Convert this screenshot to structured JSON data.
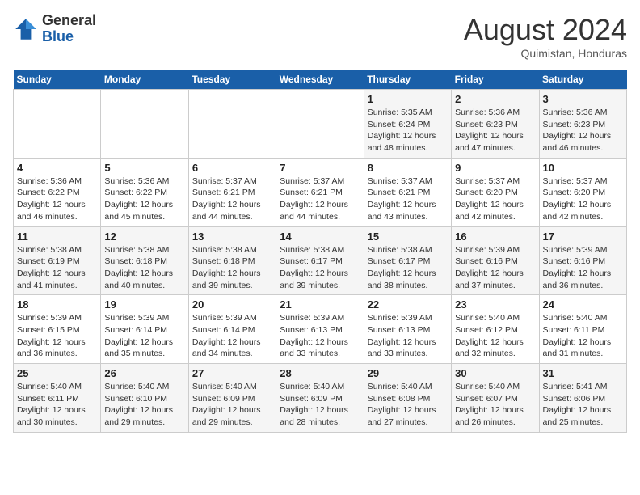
{
  "logo": {
    "general": "General",
    "blue": "Blue"
  },
  "title": "August 2024",
  "subtitle": "Quimistan, Honduras",
  "days_of_week": [
    "Sunday",
    "Monday",
    "Tuesday",
    "Wednesday",
    "Thursday",
    "Friday",
    "Saturday"
  ],
  "weeks": [
    [
      {
        "day": "",
        "info": ""
      },
      {
        "day": "",
        "info": ""
      },
      {
        "day": "",
        "info": ""
      },
      {
        "day": "",
        "info": ""
      },
      {
        "day": "1",
        "info": "Sunrise: 5:35 AM\nSunset: 6:24 PM\nDaylight: 12 hours\nand 48 minutes."
      },
      {
        "day": "2",
        "info": "Sunrise: 5:36 AM\nSunset: 6:23 PM\nDaylight: 12 hours\nand 47 minutes."
      },
      {
        "day": "3",
        "info": "Sunrise: 5:36 AM\nSunset: 6:23 PM\nDaylight: 12 hours\nand 46 minutes."
      }
    ],
    [
      {
        "day": "4",
        "info": "Sunrise: 5:36 AM\nSunset: 6:22 PM\nDaylight: 12 hours\nand 46 minutes."
      },
      {
        "day": "5",
        "info": "Sunrise: 5:36 AM\nSunset: 6:22 PM\nDaylight: 12 hours\nand 45 minutes."
      },
      {
        "day": "6",
        "info": "Sunrise: 5:37 AM\nSunset: 6:21 PM\nDaylight: 12 hours\nand 44 minutes."
      },
      {
        "day": "7",
        "info": "Sunrise: 5:37 AM\nSunset: 6:21 PM\nDaylight: 12 hours\nand 44 minutes."
      },
      {
        "day": "8",
        "info": "Sunrise: 5:37 AM\nSunset: 6:21 PM\nDaylight: 12 hours\nand 43 minutes."
      },
      {
        "day": "9",
        "info": "Sunrise: 5:37 AM\nSunset: 6:20 PM\nDaylight: 12 hours\nand 42 minutes."
      },
      {
        "day": "10",
        "info": "Sunrise: 5:37 AM\nSunset: 6:20 PM\nDaylight: 12 hours\nand 42 minutes."
      }
    ],
    [
      {
        "day": "11",
        "info": "Sunrise: 5:38 AM\nSunset: 6:19 PM\nDaylight: 12 hours\nand 41 minutes."
      },
      {
        "day": "12",
        "info": "Sunrise: 5:38 AM\nSunset: 6:18 PM\nDaylight: 12 hours\nand 40 minutes."
      },
      {
        "day": "13",
        "info": "Sunrise: 5:38 AM\nSunset: 6:18 PM\nDaylight: 12 hours\nand 39 minutes."
      },
      {
        "day": "14",
        "info": "Sunrise: 5:38 AM\nSunset: 6:17 PM\nDaylight: 12 hours\nand 39 minutes."
      },
      {
        "day": "15",
        "info": "Sunrise: 5:38 AM\nSunset: 6:17 PM\nDaylight: 12 hours\nand 38 minutes."
      },
      {
        "day": "16",
        "info": "Sunrise: 5:39 AM\nSunset: 6:16 PM\nDaylight: 12 hours\nand 37 minutes."
      },
      {
        "day": "17",
        "info": "Sunrise: 5:39 AM\nSunset: 6:16 PM\nDaylight: 12 hours\nand 36 minutes."
      }
    ],
    [
      {
        "day": "18",
        "info": "Sunrise: 5:39 AM\nSunset: 6:15 PM\nDaylight: 12 hours\nand 36 minutes."
      },
      {
        "day": "19",
        "info": "Sunrise: 5:39 AM\nSunset: 6:14 PM\nDaylight: 12 hours\nand 35 minutes."
      },
      {
        "day": "20",
        "info": "Sunrise: 5:39 AM\nSunset: 6:14 PM\nDaylight: 12 hours\nand 34 minutes."
      },
      {
        "day": "21",
        "info": "Sunrise: 5:39 AM\nSunset: 6:13 PM\nDaylight: 12 hours\nand 33 minutes."
      },
      {
        "day": "22",
        "info": "Sunrise: 5:39 AM\nSunset: 6:13 PM\nDaylight: 12 hours\nand 33 minutes."
      },
      {
        "day": "23",
        "info": "Sunrise: 5:40 AM\nSunset: 6:12 PM\nDaylight: 12 hours\nand 32 minutes."
      },
      {
        "day": "24",
        "info": "Sunrise: 5:40 AM\nSunset: 6:11 PM\nDaylight: 12 hours\nand 31 minutes."
      }
    ],
    [
      {
        "day": "25",
        "info": "Sunrise: 5:40 AM\nSunset: 6:11 PM\nDaylight: 12 hours\nand 30 minutes."
      },
      {
        "day": "26",
        "info": "Sunrise: 5:40 AM\nSunset: 6:10 PM\nDaylight: 12 hours\nand 29 minutes."
      },
      {
        "day": "27",
        "info": "Sunrise: 5:40 AM\nSunset: 6:09 PM\nDaylight: 12 hours\nand 29 minutes."
      },
      {
        "day": "28",
        "info": "Sunrise: 5:40 AM\nSunset: 6:09 PM\nDaylight: 12 hours\nand 28 minutes."
      },
      {
        "day": "29",
        "info": "Sunrise: 5:40 AM\nSunset: 6:08 PM\nDaylight: 12 hours\nand 27 minutes."
      },
      {
        "day": "30",
        "info": "Sunrise: 5:40 AM\nSunset: 6:07 PM\nDaylight: 12 hours\nand 26 minutes."
      },
      {
        "day": "31",
        "info": "Sunrise: 5:41 AM\nSunset: 6:06 PM\nDaylight: 12 hours\nand 25 minutes."
      }
    ]
  ]
}
